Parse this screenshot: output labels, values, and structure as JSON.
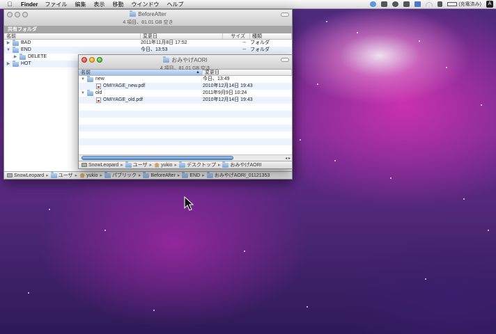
{
  "menubar": {
    "app": "Finder",
    "menus": [
      "ファイル",
      "編集",
      "表示",
      "移動",
      "ウインドウ",
      "ヘルプ"
    ],
    "battery_label": "(充電済み)",
    "icons": [
      "apple-icon",
      "dropbox-icon",
      "sync-icon",
      "timemachine-icon",
      "display-icon",
      "bluetooth-icon",
      "wifi-icon",
      "volume-icon",
      "battery-icon",
      "spotlight-icon"
    ]
  },
  "back_window": {
    "title": "BeforeAfter",
    "status": "4 項目、81.01 GB 空き",
    "section": "共有フォルダ",
    "columns": [
      "名前",
      "変更日",
      "サイズ",
      "種類"
    ],
    "rows": [
      {
        "name": "BAD",
        "date": "2011年11月8日 17:52",
        "size": "--",
        "kind": "フォルダ"
      },
      {
        "name": "END",
        "date": "今日、13:53",
        "size": "--",
        "kind": "フォルダ"
      },
      {
        "name": "DELETE",
        "date": "",
        "size": "",
        "kind": ""
      },
      {
        "name": "HOT",
        "date": "",
        "size": "",
        "kind": ""
      }
    ],
    "path": [
      "SnowLeopard",
      "ユーザ",
      "yukio",
      "パブリック",
      "BeforeAfter",
      "END",
      "おみやげAORI_01121353"
    ]
  },
  "front_window": {
    "title": "おみやげAORI",
    "status": "4 項目、81.01 GB 空き",
    "columns": [
      "名前",
      "変更日"
    ],
    "rows": [
      {
        "name": "new",
        "date": "今日、13:49"
      },
      {
        "name": "OMIYAGE_new.pdf",
        "date": "2010年12月14日 19:43"
      },
      {
        "name": "old",
        "date": "2011年9月9日 10:24"
      },
      {
        "name": "OMIYAGE_old.pdf",
        "date": "2010年12月14日 19:43"
      }
    ],
    "path": [
      "SnowLeopard",
      "ユーザ",
      "yukio",
      "デスクトップ",
      "おみやげAORI"
    ]
  }
}
